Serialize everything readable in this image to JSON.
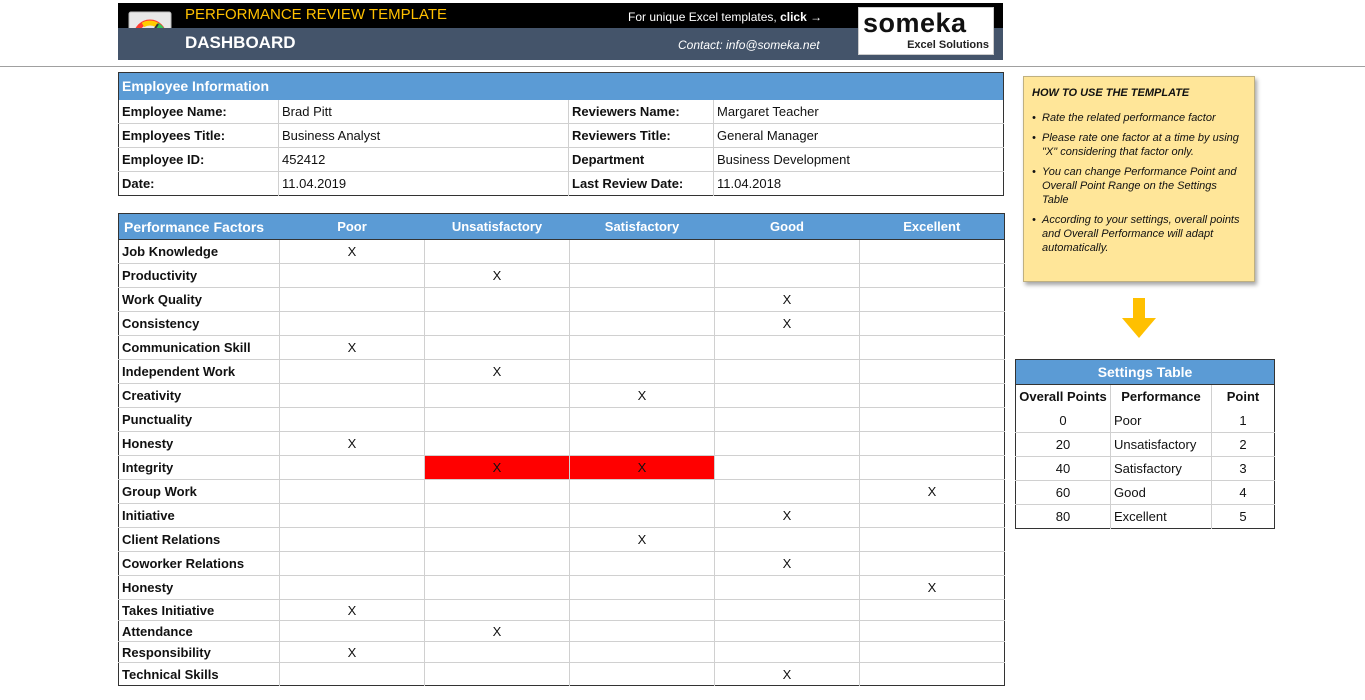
{
  "header": {
    "title": "PERFORMANCE REVIEW TEMPLATE",
    "subtitle": "DASHBOARD",
    "promo_text": "For unique Excel templates, ",
    "promo_link": "click →",
    "contact": "Contact: info@someka.net",
    "logo_main": "someka",
    "logo_sub": "Excel Solutions",
    "colors": {
      "banner_top": "#000000",
      "banner_bottom": "#44546a",
      "title": "#ffc000"
    }
  },
  "employee_info": {
    "section_title": "Employee Information",
    "rows": [
      {
        "label": "Employee Name:",
        "value": "Brad Pitt",
        "label2": "Reviewers Name:",
        "value2": "Margaret Teacher"
      },
      {
        "label": "Employees Title:",
        "value": "Business Analyst",
        "label2": "Reviewers Title:",
        "value2": "General Manager"
      },
      {
        "label": "Employee ID:",
        "value": "452412",
        "label2": "Department",
        "value2": "Business Development"
      },
      {
        "label": "Date:",
        "value": "11.04.2019",
        "label2": "Last Review Date:",
        "value2": "11.04.2018"
      }
    ]
  },
  "performance": {
    "headers": [
      "Performance Factors",
      "Poor",
      "Unsatisfactory",
      "Satisfactory",
      "Good",
      "Excellent"
    ],
    "mark": "X",
    "header_color": "#5b9bd5",
    "error_color": "#ff0000",
    "rows": [
      {
        "factor": "Job Knowledge",
        "marks": [
          "X",
          "",
          "",
          "",
          ""
        ]
      },
      {
        "factor": "Productivity",
        "marks": [
          "",
          "X",
          "",
          "",
          ""
        ]
      },
      {
        "factor": "Work Quality",
        "marks": [
          "",
          "",
          "",
          "X",
          ""
        ]
      },
      {
        "factor": "Consistency",
        "marks": [
          "",
          "",
          "",
          "X",
          ""
        ]
      },
      {
        "factor": "Communication Skill",
        "marks": [
          "X",
          "",
          "",
          "",
          ""
        ]
      },
      {
        "factor": "Independent Work",
        "marks": [
          "",
          "X",
          "",
          "",
          ""
        ]
      },
      {
        "factor": "Creativity",
        "marks": [
          "",
          "",
          "X",
          "",
          ""
        ]
      },
      {
        "factor": "Punctuality",
        "marks": [
          "",
          "",
          "",
          "",
          ""
        ]
      },
      {
        "factor": "Honesty",
        "marks": [
          "X",
          "",
          "",
          "",
          ""
        ]
      },
      {
        "factor": "Integrity",
        "marks": [
          "",
          "X",
          "X",
          "",
          ""
        ],
        "highlight": [
          false,
          true,
          true,
          false,
          false
        ]
      },
      {
        "factor": "Group Work",
        "marks": [
          "",
          "",
          "",
          "",
          "X"
        ]
      },
      {
        "factor": "Initiative",
        "marks": [
          "",
          "",
          "",
          "X",
          ""
        ]
      },
      {
        "factor": "Client Relations",
        "marks": [
          "",
          "",
          "X",
          "",
          ""
        ]
      },
      {
        "factor": "Coworker Relations",
        "marks": [
          "",
          "",
          "",
          "X",
          ""
        ]
      },
      {
        "factor": "Honesty",
        "marks": [
          "",
          "",
          "",
          "",
          "X"
        ]
      },
      {
        "factor": "Takes Initiative",
        "marks": [
          "X",
          "",
          "",
          "",
          ""
        ]
      },
      {
        "factor": "Attendance",
        "marks": [
          "",
          "X",
          "",
          "",
          ""
        ]
      },
      {
        "factor": "Responsibility",
        "marks": [
          "X",
          "",
          "",
          "",
          ""
        ]
      },
      {
        "factor": "Technical Skills",
        "marks": [
          "",
          "",
          "",
          "X",
          ""
        ]
      }
    ]
  },
  "how_to": {
    "title": "HOW TO USE THE TEMPLATE",
    "items": [
      "Rate the related performance factor",
      "Please rate one factor at a time by using \"X\" considering that factor only.",
      "You can change Performance Point and Overall Point Range on the Settings Table",
      "According to your settings, overall points and Overall Performance will adapt automatically."
    ],
    "background": "#ffe699"
  },
  "arrow_icon": "arrow-down-icon",
  "settings": {
    "title": "Settings Table",
    "headers": [
      "Overall Points",
      "Performance",
      "Point"
    ],
    "rows": [
      {
        "overall": "0",
        "performance": "Poor",
        "point": "1"
      },
      {
        "overall": "20",
        "performance": "Unsatisfactory",
        "point": "2"
      },
      {
        "overall": "40",
        "performance": "Satisfactory",
        "point": "3"
      },
      {
        "overall": "60",
        "performance": "Good",
        "point": "4"
      },
      {
        "overall": "80",
        "performance": "Excellent",
        "point": "5"
      }
    ]
  }
}
